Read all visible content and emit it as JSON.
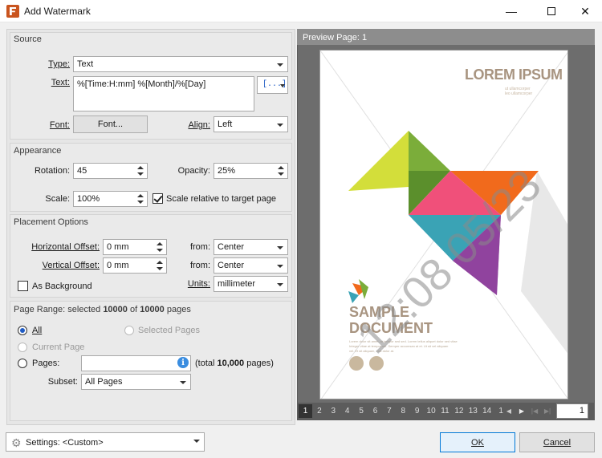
{
  "window": {
    "title": "Add Watermark"
  },
  "source": {
    "heading": "Source",
    "type_label": "Type:",
    "type_value": "Text",
    "text_label": "Text:",
    "text_value": "%[Time:H:mm] %[Month]/%[Day]",
    "macro_button": "[...]",
    "font_label": "Font:",
    "font_button": "Font...",
    "align_label": "Align:",
    "align_value": "Left"
  },
  "appearance": {
    "heading": "Appearance",
    "rotation_label": "Rotation:",
    "rotation_value": "45",
    "opacity_label": "Opacity:",
    "opacity_value": "25%",
    "scale_label": "Scale:",
    "scale_value": "100%",
    "scale_relative_label": "Scale relative to target page",
    "scale_relative_checked": true
  },
  "placement": {
    "heading": "Placement Options",
    "h_offset_label": "Horizontal Offset:",
    "h_offset_value": "0 mm",
    "v_offset_label": "Vertical Offset:",
    "v_offset_value": "0 mm",
    "from_label": "from:",
    "h_from_value": "Center",
    "v_from_value": "Center",
    "background_label": "As Background",
    "background_checked": false,
    "units_label": "Units:",
    "units_value": "millimeter"
  },
  "page_range": {
    "heading_prefix": "Page Range: selected ",
    "selected": "10000",
    "heading_mid": " of ",
    "total": "10000",
    "heading_suffix": " pages",
    "all_label": "All",
    "selected_pages_label": "Selected Pages",
    "current_page_label": "Current Page",
    "pages_label": "Pages:",
    "pages_value": "",
    "total_text_prefix": "(total ",
    "total_text_count": "10,000",
    "total_text_suffix": " pages)",
    "subset_label": "Subset:",
    "subset_value": "All Pages"
  },
  "preview": {
    "title": "Preview Page: 1",
    "page_numbers": [
      "1",
      "2",
      "3",
      "4",
      "5",
      "6",
      "7",
      "8",
      "9",
      "10",
      "11",
      "12",
      "13",
      "14",
      "1"
    ],
    "current_page": "1",
    "page_input": "1",
    "doc": {
      "heading": "LOREM IPSUM",
      "subheading_line1": "ut ullamcorper",
      "subheading_line2": "leo ullamcorper",
      "sample_line1": "SAMPLE",
      "sample_line2": "DOCUMENT",
      "body_line1": "Lorem dolor sit amet, at tempor sed sed. Lorem tellus aliquet dolor sed vitae",
      "body_line2": "Integer vitae at tempor vel. Semper accumsan at et. Ut sit vel aliquam",
      "body_line3": "vel. Et sit aliquam, erat dolor at."
    },
    "watermark_text": "12:08 05/23"
  },
  "footer": {
    "settings_label": "Settings:",
    "settings_value": "<Custom>",
    "ok_label": "OK",
    "cancel_label": "Cancel"
  },
  "colors": {
    "accent": "#1e5bc4",
    "brand": "#c9541e",
    "heading_tan": "#a89480"
  }
}
